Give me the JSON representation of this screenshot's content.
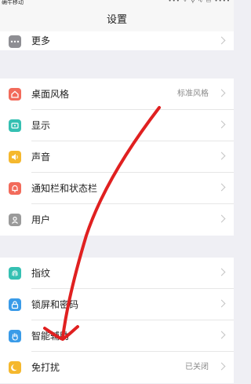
{
  "status_bar": {
    "carrier": "确牛移动",
    "right": "••• ⚬ ⚲ ∿ ▭ ••••"
  },
  "header": {
    "title": "设置"
  },
  "groups": [
    {
      "items": [
        {
          "label": "更多",
          "value": "",
          "icon": "more-icon",
          "color": "#8e8e93"
        }
      ]
    },
    {
      "items": [
        {
          "label": "桌面风格",
          "value": "标准风格",
          "icon": "home-icon",
          "color": "#f26b5b"
        },
        {
          "label": "显示",
          "value": "",
          "icon": "display-icon",
          "color": "#35c0b2"
        },
        {
          "label": "声音",
          "value": "",
          "icon": "sound-icon",
          "color": "#f5b82e"
        },
        {
          "label": "通知栏和状态栏",
          "value": "",
          "icon": "notification-bell-icon",
          "color": "#f26b5b"
        },
        {
          "label": "用户",
          "value": "",
          "icon": "user-icon",
          "color": "#9a9a9a"
        }
      ]
    },
    {
      "items": [
        {
          "label": "指纹",
          "value": "",
          "icon": "fingerprint-icon",
          "color": "#35c0b2"
        },
        {
          "label": "锁屏和密码",
          "value": "",
          "icon": "lock-icon",
          "color": "#3a9be8"
        },
        {
          "label": "智能辅助",
          "value": "",
          "icon": "hand-icon",
          "color": "#3a9be8"
        },
        {
          "label": "免打扰",
          "value": "已关闭",
          "icon": "moon-icon",
          "color": "#f5b82e"
        }
      ]
    }
  ],
  "annotation": {
    "color": "#e02020"
  }
}
